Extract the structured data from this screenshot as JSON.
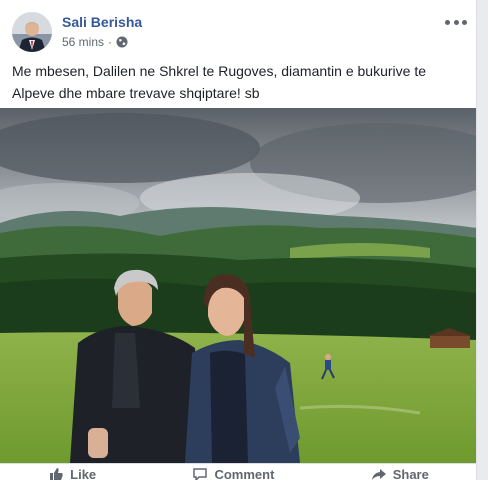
{
  "post": {
    "author": "Sali Berisha",
    "time": "56 mins",
    "separator": "·",
    "visibility_icon": "globe-icon",
    "text": "Me mbesen, Dalilen ne Shkrel te Rugoves, diamantin e bukurive te Alpeve dhe mbare trevave shqiptare! sb"
  },
  "actions": [
    {
      "label": "Like",
      "icon": "like-icon"
    },
    {
      "label": "Comment",
      "icon": "comment-icon"
    },
    {
      "label": "Share",
      "icon": "share-icon"
    }
  ],
  "colors": {
    "author_link": "#365899",
    "meta_text": "#616770",
    "body_text": "#1d2129"
  }
}
